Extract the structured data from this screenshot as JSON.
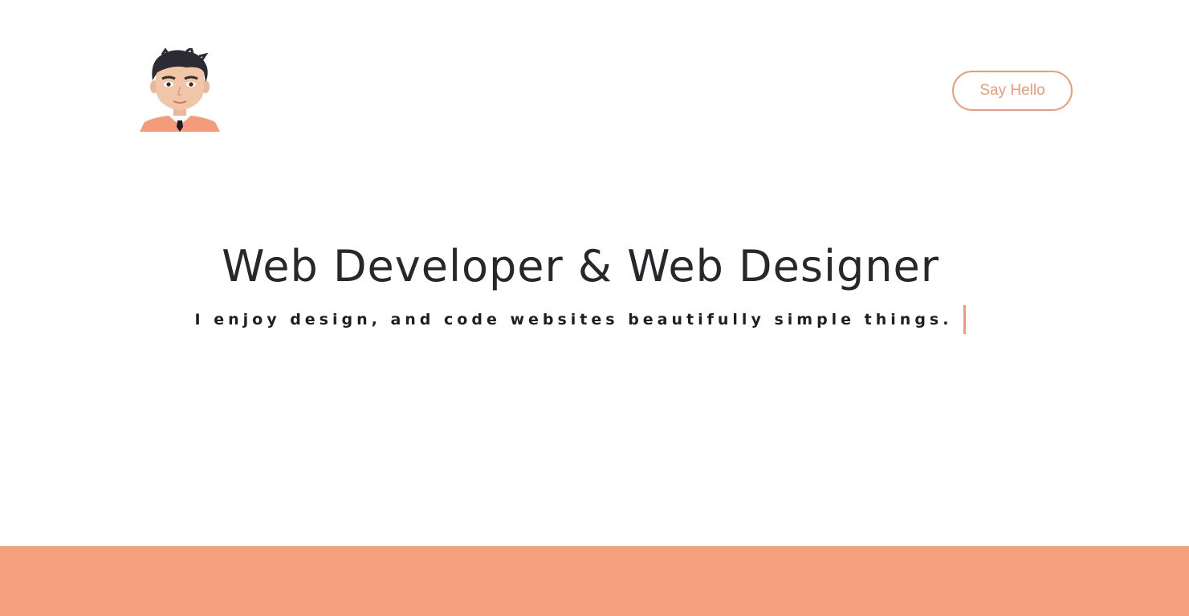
{
  "header": {
    "avatar_icon": "avatar-icon",
    "say_hello_label": "Say Hello"
  },
  "hero": {
    "title": "Web Developer & Web Designer",
    "subtitle": "I enjoy design, and code websites beautifully simple things."
  },
  "colors": {
    "accent": "#f19a75",
    "footer": "#f59f7c",
    "text": "#26282c",
    "background": "#ffffff"
  }
}
